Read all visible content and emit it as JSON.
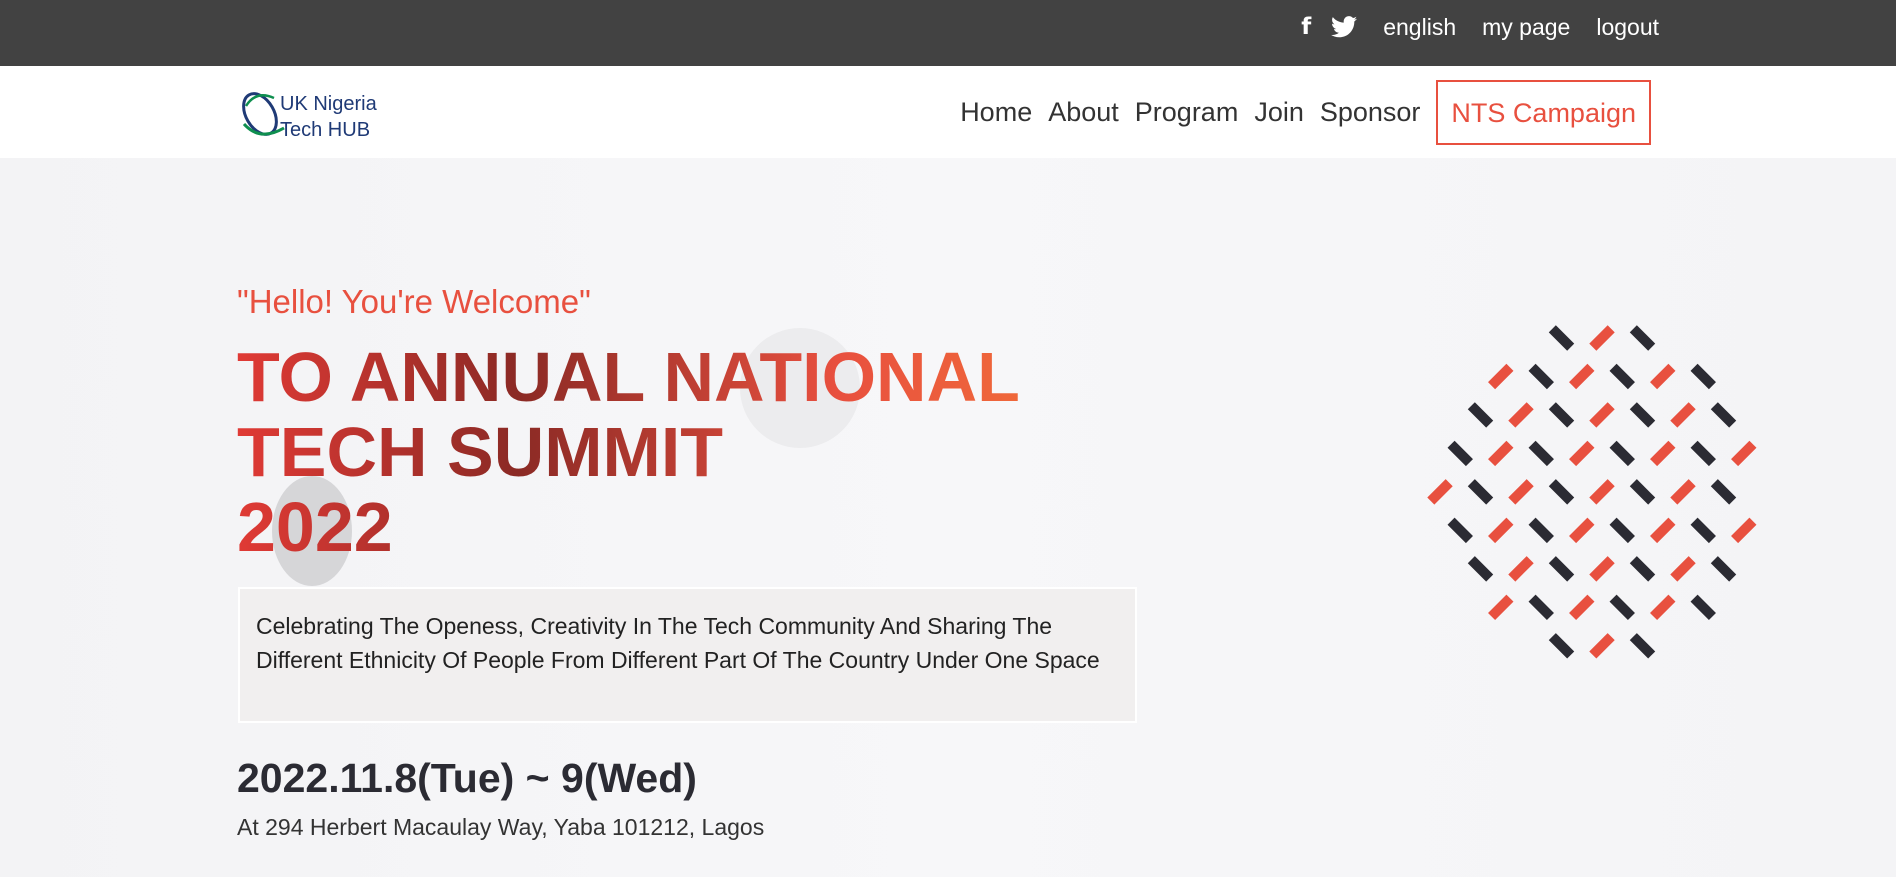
{
  "topbar": {
    "facebook_icon": "f",
    "twitter_icon": "twitter-icon",
    "language": "english",
    "my_page": "my page",
    "logout": "logout"
  },
  "logo": {
    "line1": "UK Nigeria",
    "line2": "Tech HUB"
  },
  "nav": {
    "items": [
      "Home",
      "About",
      "Program",
      "Join",
      "Sponsor"
    ],
    "campaign": "NTS Campaign"
  },
  "hero": {
    "welcome": "\"Hello! You're Welcome\"",
    "title_lines": [
      "TO ANNUAL NATIONAL",
      "TECH SUMMIT",
      "2022"
    ],
    "description": "Celebrating The Openess, Creativity In The Tech Community And Sharing The Different Ethnicity Of People From Different Part Of The Country Under One Space",
    "date": "2022.11.8(Tue) ~ 9(Wed)",
    "address": "At 294 Herbert Macaulay Way, Yaba 101212, Lagos"
  },
  "colors": {
    "accent": "#e8503f",
    "topbar_bg": "#424242",
    "pattern_red": "#e8503f",
    "pattern_dark": "#2b2b33"
  }
}
